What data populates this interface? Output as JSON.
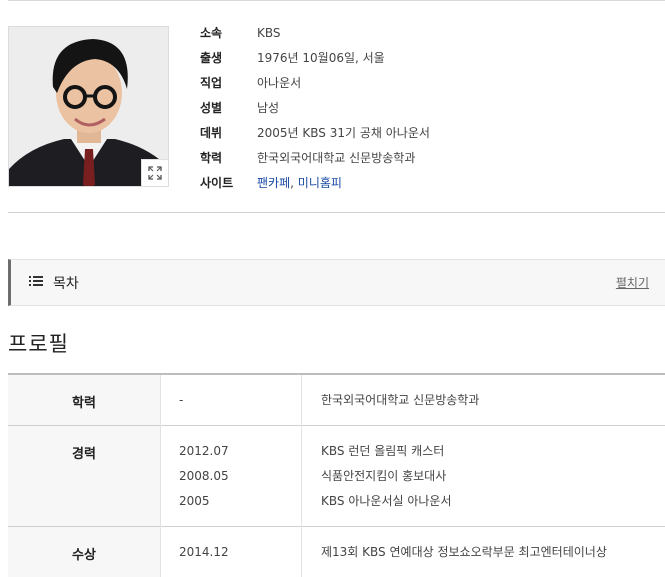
{
  "profile": {
    "photo_alt": "",
    "expand_icon": "expand-icon",
    "fields": [
      {
        "label": "소속",
        "value": "KBS"
      },
      {
        "label": "출생",
        "value": "1976년 10월06일, 서울"
      },
      {
        "label": "직업",
        "value": "아나운서"
      },
      {
        "label": "성별",
        "value": "남성"
      },
      {
        "label": "데뷔",
        "value": "2005년 KBS 31기 공채 아나운서"
      },
      {
        "label": "학력",
        "value": "한국외국어대학교 신문방송학과"
      }
    ],
    "site": {
      "label": "사이트",
      "link1": "팬카페",
      "separator": ",",
      "link2": "미니홈피"
    }
  },
  "toc": {
    "icon": "list-icon",
    "title": "목차",
    "toggle_label": "펼치기"
  },
  "section": {
    "title": "프로필"
  },
  "table": {
    "rows": [
      {
        "header": "학력",
        "entries": [
          {
            "date": "-",
            "desc": "한국외국어대학교 신문방송학과"
          }
        ]
      },
      {
        "header": "경력",
        "entries": [
          {
            "date": "2012.07",
            "desc": "KBS 런던 올림픽 캐스터"
          },
          {
            "date": "2008.05",
            "desc": "식품안전지킴이 홍보대사"
          },
          {
            "date": "2005",
            "desc": "KBS 아나운서실 아나운서"
          }
        ]
      },
      {
        "header": "수상",
        "entries": [
          {
            "date": "2014.12",
            "desc": "제13회 KBS 연예대상 정보쇼오락부문 최고엔터테이너상"
          }
        ]
      }
    ]
  },
  "colors": {
    "link": "#1a4aa3",
    "toc_bar": "#6d6d6d",
    "header_bg": "#f7f7f7"
  }
}
